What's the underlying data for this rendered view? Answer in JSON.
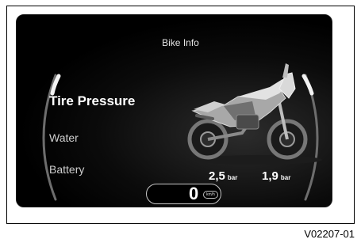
{
  "header": {
    "title": "Bike Info"
  },
  "menu": {
    "items": [
      {
        "label": "Tire Pressure"
      },
      {
        "label": "Water"
      },
      {
        "label": "Battery"
      }
    ]
  },
  "tire_pressure": {
    "front": {
      "value": "2,5",
      "unit": "bar"
    },
    "rear": {
      "value": "1,9",
      "unit": "bar"
    }
  },
  "speed": {
    "value": "0",
    "unit": "km/h"
  },
  "figure_code": "V02207-01",
  "colors": {
    "screen_bg": "#000000",
    "text": "#ffffff",
    "gauge_arc": "#9a9a9a"
  }
}
